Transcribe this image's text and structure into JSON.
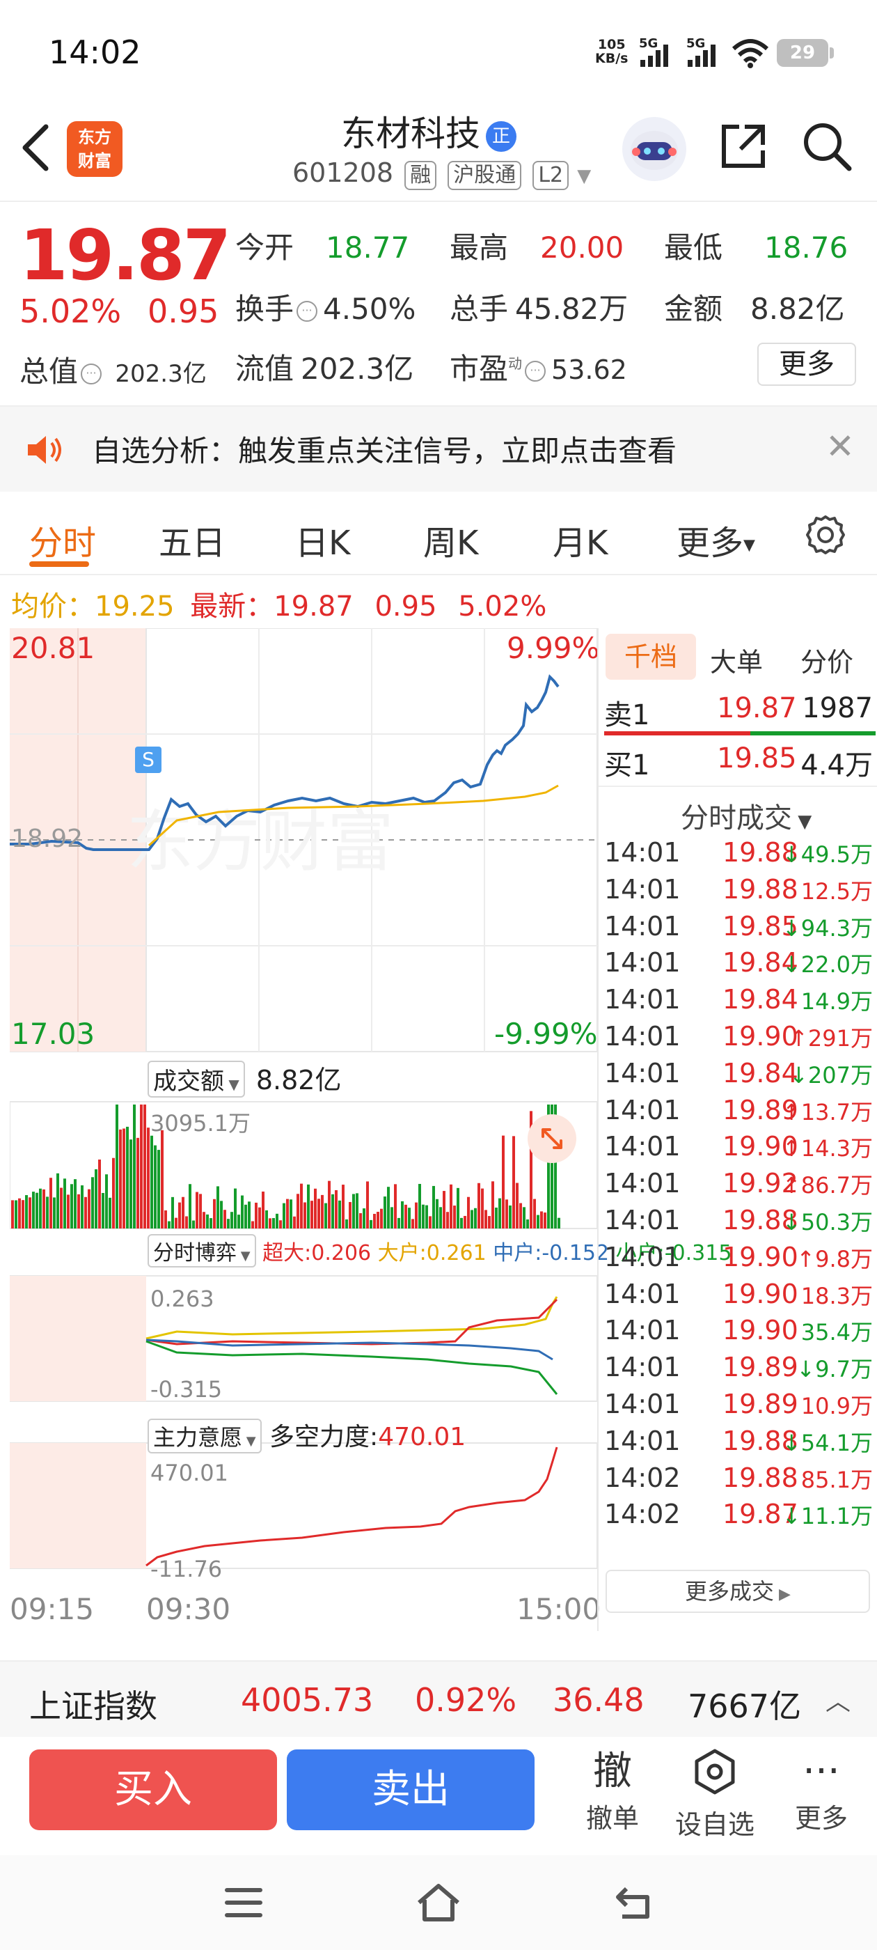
{
  "status_bar": {
    "time": "14:02",
    "net_speed": "105\nKB/s",
    "net_speed_top": "105",
    "net_speed_bottom": "KB/s",
    "sim1": "5G",
    "sim2": "5G",
    "battery": "29"
  },
  "header": {
    "logo_line1": "东方",
    "logo_line2": "财富",
    "stock_name": "东材科技",
    "badge": "正",
    "code": "601208",
    "tags": [
      "融",
      "沪股通",
      "L2"
    ]
  },
  "quote": {
    "price": "19.87",
    "change_pct": "5.02%",
    "change_amt": "0.95",
    "stats": {
      "open_label": "今开",
      "open": "18.77",
      "high_label": "最高",
      "high": "20.00",
      "low_label": "最低",
      "low": "18.76",
      "turnover_label": "换手",
      "turnover": "4.50%",
      "volume_label": "总手",
      "volume": "45.82万",
      "amount_label": "金额",
      "amount": "8.82亿",
      "mcap_label": "总值",
      "mcap": "202.3亿",
      "float_label": "流值",
      "float": "202.3亿",
      "pe_label": "市盈",
      "pe_sup": "动",
      "pe": "53.62"
    },
    "more_button": "更多"
  },
  "banner": {
    "text": "自选分析：触发重点关注信号，立即点击查看"
  },
  "tabs": [
    "分时",
    "五日",
    "日K",
    "周K",
    "月K",
    "更多"
  ],
  "info_line": {
    "avg_label": "均价：",
    "avg": "19.25",
    "latest_label": "最新：",
    "latest": "19.87",
    "chg": "0.95",
    "pct": "5.02%"
  },
  "chart": {
    "price_top": "20.81",
    "price_prev": "18.92",
    "price_bottom": "17.03",
    "pct_top": "9.99%",
    "pct_bottom": "-9.99%",
    "signal_mark": "S",
    "amount_label": "成交额",
    "amount_value": "8.82亿",
    "amount_max": "3095.1万",
    "bobo_label": "分时博弈",
    "bobo_super": "超大:0.206",
    "bobo_large": "大户:0.261",
    "bobo_mid": "中户:-0.152",
    "bobo_small": "小户:-0.315",
    "bobo_top": "0.263",
    "bobo_bottom": "-0.315",
    "main_label": "主力意愿",
    "main_force_label": "多空力度:",
    "main_force_value": "470.01",
    "main_top": "470.01",
    "main_bottom": "-11.76",
    "time_start": "09:15",
    "time_open": "09:30",
    "time_end": "15:00",
    "colors": {
      "price_line": "#2f6db5",
      "avg_line": "#f0b400",
      "up": "#e02a2a",
      "down": "#149c2c"
    }
  },
  "order_book": {
    "tabs": [
      "千档",
      "大单",
      "分价"
    ],
    "sell1_label": "卖1",
    "sell1_price": "19.87",
    "sell1_vol": "1987",
    "buy1_label": "买1",
    "buy1_price": "19.85",
    "buy1_vol": "4.4万",
    "trades_title": "分时成交",
    "trades": [
      {
        "t": "14:01",
        "p": "19.88",
        "v": "↓49.5万",
        "dir": "down"
      },
      {
        "t": "14:01",
        "p": "19.88",
        "v": "12.5万",
        "dir": "up"
      },
      {
        "t": "14:01",
        "p": "19.85",
        "v": "↓94.3万",
        "dir": "down"
      },
      {
        "t": "14:01",
        "p": "19.84",
        "v": "↓22.0万",
        "dir": "down"
      },
      {
        "t": "14:01",
        "p": "19.84",
        "v": "14.9万",
        "dir": "down"
      },
      {
        "t": "14:01",
        "p": "19.90",
        "v": "↑291万",
        "dir": "up"
      },
      {
        "t": "14:01",
        "p": "19.84",
        "v": "↓207万",
        "dir": "down"
      },
      {
        "t": "14:01",
        "p": "19.89",
        "v": "↑13.7万",
        "dir": "up"
      },
      {
        "t": "14:01",
        "p": "19.90",
        "v": "↑14.3万",
        "dir": "up"
      },
      {
        "t": "14:01",
        "p": "19.92",
        "v": "↑86.7万",
        "dir": "up"
      },
      {
        "t": "14:01",
        "p": "19.88",
        "v": "↓50.3万",
        "dir": "down"
      },
      {
        "t": "14:01",
        "p": "19.90",
        "v": "↑9.8万",
        "dir": "up"
      },
      {
        "t": "14:01",
        "p": "19.90",
        "v": "18.3万",
        "dir": "up"
      },
      {
        "t": "14:01",
        "p": "19.90",
        "v": "35.4万",
        "dir": "down"
      },
      {
        "t": "14:01",
        "p": "19.89",
        "v": "↓9.7万",
        "dir": "down"
      },
      {
        "t": "14:01",
        "p": "19.89",
        "v": "10.9万",
        "dir": "up"
      },
      {
        "t": "14:01",
        "p": "19.88",
        "v": "↓54.1万",
        "dir": "down"
      },
      {
        "t": "14:02",
        "p": "19.88",
        "v": "85.1万",
        "dir": "up"
      },
      {
        "t": "14:02",
        "p": "19.87",
        "v": "↓11.1万",
        "dir": "down"
      }
    ],
    "more_trades": "更多成交"
  },
  "index_bar": {
    "name": "上证指数",
    "value": "4005.73",
    "pct": "0.92%",
    "chg": "36.48",
    "amount": "7667亿"
  },
  "actions": {
    "buy": "买入",
    "sell": "卖出",
    "cancel_icon_text": "撤",
    "cancel": "撤单",
    "watch": "设自选",
    "more": "更多"
  }
}
